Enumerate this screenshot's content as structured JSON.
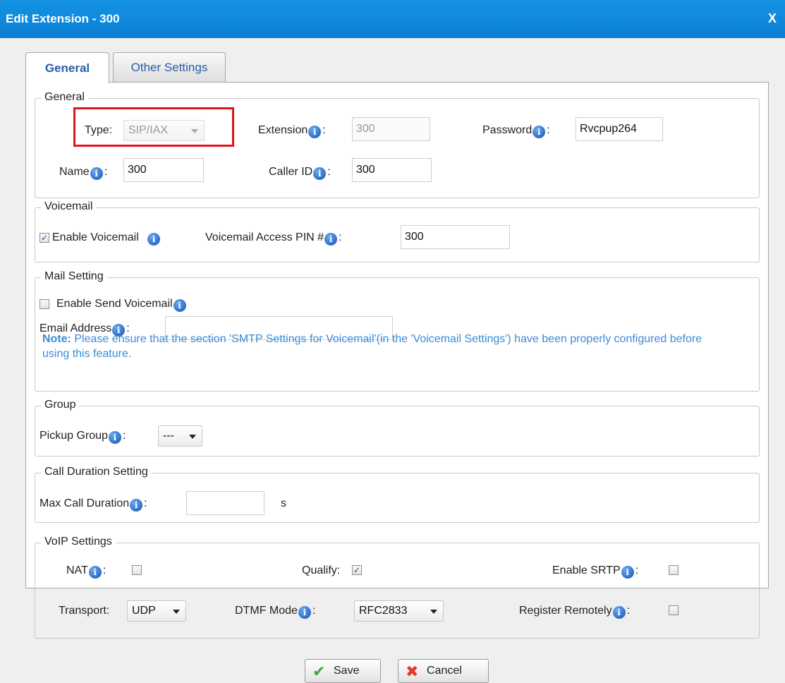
{
  "window": {
    "title": "Edit Extension - 300",
    "close": "X"
  },
  "tabs": [
    {
      "label": "General"
    },
    {
      "label": "Other Settings"
    }
  ],
  "general": {
    "legend": "General",
    "type_label": "Type:",
    "type_value": "SIP/IAX",
    "extension_label": "Extension",
    "extension_value": "300",
    "password_label": "Password",
    "password_value": "Rvcpup264",
    "name_label": "Name",
    "name_value": "300",
    "callerid_label": "Caller ID",
    "callerid_value": "300"
  },
  "voicemail": {
    "legend": "Voicemail",
    "enable_label": "Enable Voicemail",
    "enable_checked": true,
    "pin_label": "Voicemail Access PIN #",
    "pin_value": "300"
  },
  "mail": {
    "legend": "Mail Setting",
    "send_label": "Enable Send Voicemail",
    "send_checked": false,
    "email_label": "Email Address",
    "email_value": "",
    "note_prefix": "Note:",
    "note_text": " Please ensure that the section 'SMTP Settings for Voicemail'(in the 'Voicemail Settings') have been properly configured before using this feature."
  },
  "group": {
    "legend": "Group",
    "pickup_label": "Pickup Group",
    "pickup_value": "---"
  },
  "duration": {
    "legend": "Call Duration Setting",
    "max_label": "Max Call Duration",
    "max_value": "",
    "unit": "s"
  },
  "voip": {
    "legend": "VoIP Settings",
    "nat_label": "NAT",
    "nat_checked": false,
    "qualify_label": "Qualify:",
    "qualify_checked": true,
    "srtp_label": "Enable SRTP",
    "srtp_checked": false,
    "transport_label": "Transport:",
    "transport_value": "UDP",
    "dtmf_label": "DTMF Mode",
    "dtmf_value": "RFC2833",
    "register_label": "Register Remotely",
    "register_checked": false
  },
  "buttons": {
    "save": "Save",
    "cancel": "Cancel"
  },
  "colors": {
    "titlebar": "#0a7fd3",
    "highlight": "#e0141e",
    "link": "#2a5da8"
  }
}
